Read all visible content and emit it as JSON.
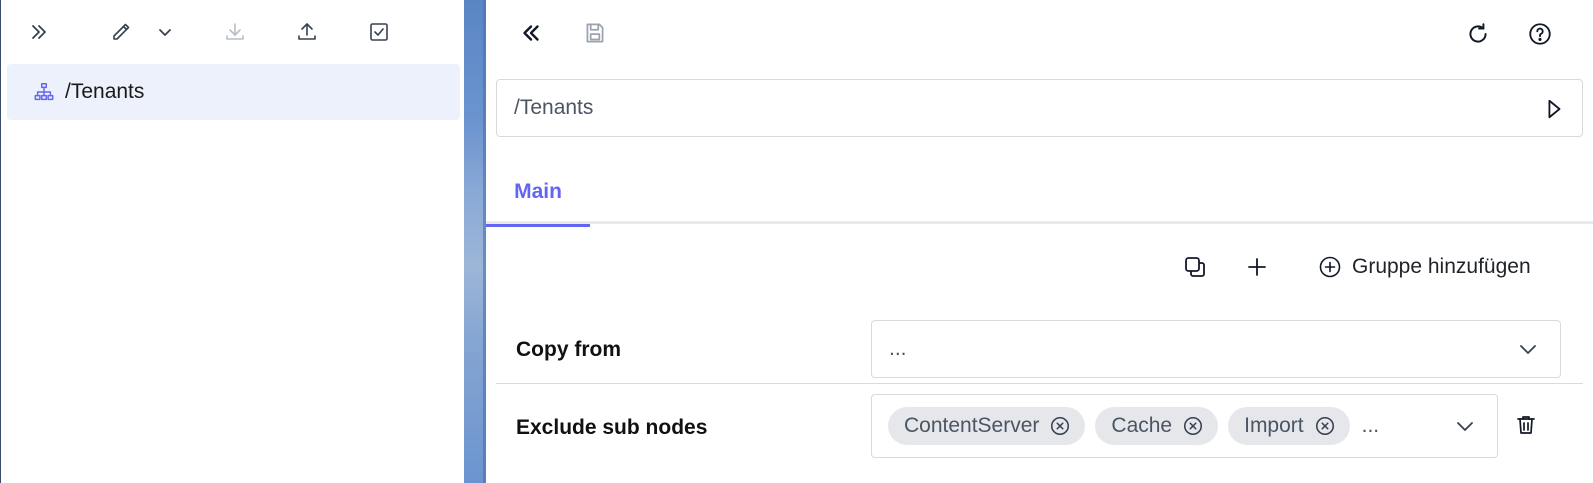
{
  "left_panel": {
    "toolbar_icons": [
      "expand-panel-icon",
      "edit-icon",
      "chevron-down-icon",
      "download-icon",
      "upload-icon",
      "checkbox-icon"
    ],
    "tree_item": {
      "icon": "sitemap-icon",
      "label": "/Tenants"
    }
  },
  "right_panel": {
    "toolbar_icons": [
      "collapse-panel-icon",
      "save-icon",
      "refresh-icon",
      "help-icon"
    ],
    "path": {
      "value": "/Tenants",
      "action_icon": "play-icon"
    },
    "tabs": [
      {
        "label": "Main",
        "active": true
      }
    ],
    "actions": {
      "copy_icon": "copy-icon",
      "add_icon": "plus-icon",
      "add_group_label": "Gruppe hinzufügen"
    },
    "fields": [
      {
        "label": "Copy from",
        "value": "..."
      },
      {
        "label": "Exclude sub nodes",
        "chips": [
          "ContentServer",
          "Cache",
          "Import"
        ],
        "more": "..."
      }
    ]
  },
  "colors": {
    "accent": "#6366f1",
    "selected_bg": "#edf1fc",
    "chip_bg": "#e5e7eb",
    "border": "#d7dbe0"
  }
}
